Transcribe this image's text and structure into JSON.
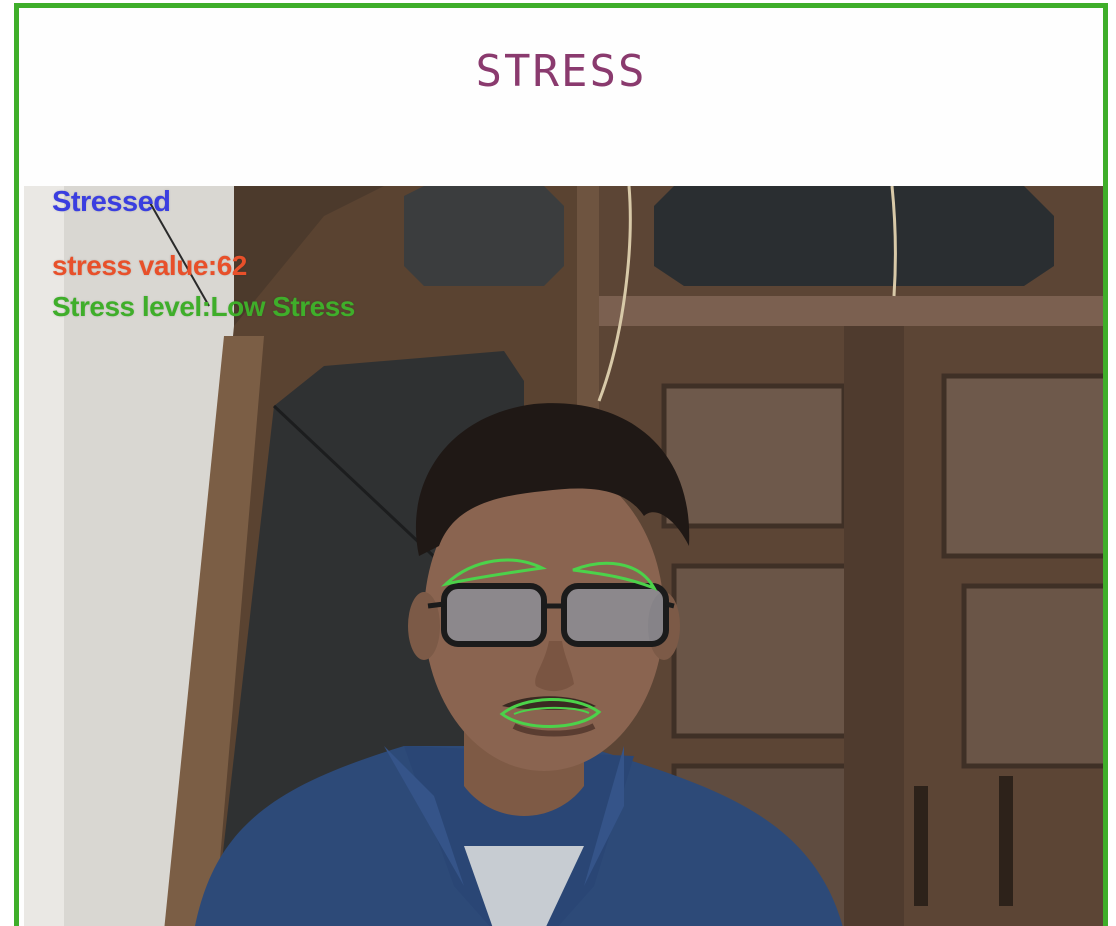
{
  "window": {
    "title": "STRESS",
    "border_color": "#3fae2a"
  },
  "feed": {
    "label": "webcam-feed",
    "status_text": "Stressed",
    "stress_value_text": "stress value:62",
    "stress_level_text": "Stress level:Low Stress",
    "colors": {
      "status": "#3a3ee0",
      "value": "#e8502a",
      "level": "#3fae2a",
      "landmarks": "#4cd24a"
    }
  }
}
